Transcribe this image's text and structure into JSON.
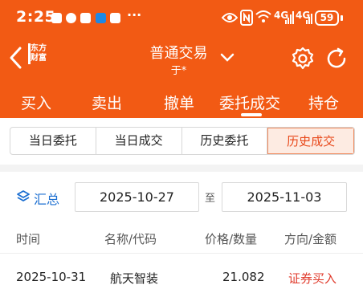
{
  "status_bar": {
    "time": "2:25",
    "signal_1": "4G",
    "signal_2": "4G",
    "battery": "59"
  },
  "nav": {
    "logo_text": "东方财富",
    "title": "普通交易",
    "subtitle": "于*"
  },
  "main_tabs": [
    {
      "label": "买入"
    },
    {
      "label": "卖出"
    },
    {
      "label": "撤单"
    },
    {
      "label": "委托成交"
    },
    {
      "label": "持仓"
    }
  ],
  "main_tabs_active": "委托成交",
  "sub_tabs": [
    {
      "label": "当日委托"
    },
    {
      "label": "当日成交"
    },
    {
      "label": "历史委托"
    },
    {
      "label": "历史成交"
    }
  ],
  "sub_tabs_active": "历史成交",
  "filter": {
    "summary_label": "汇总",
    "start_date": "2025-10-27",
    "to_label": "至",
    "end_date": "2025-11-03"
  },
  "table": {
    "columns": [
      "时间",
      "名称/代码",
      "价格/数量",
      "方向/金额"
    ],
    "rows": [
      {
        "time": "2025-10-31",
        "name": "航天智装",
        "price": "21.082",
        "direction": "证券买入"
      }
    ]
  },
  "colors": {
    "brand_orange": "#f25a14",
    "link_blue": "#1c6fd1",
    "buy_red": "#e03a2b",
    "active_tab_bg": "#fdebe2"
  },
  "icons": [
    "back-arrow-icon",
    "settings-gear-icon",
    "refresh-icon",
    "chevron-down-icon",
    "layers-icon",
    "eye-icon",
    "nfc-icon",
    "wifi-icon",
    "signal-icon",
    "battery-icon"
  ]
}
